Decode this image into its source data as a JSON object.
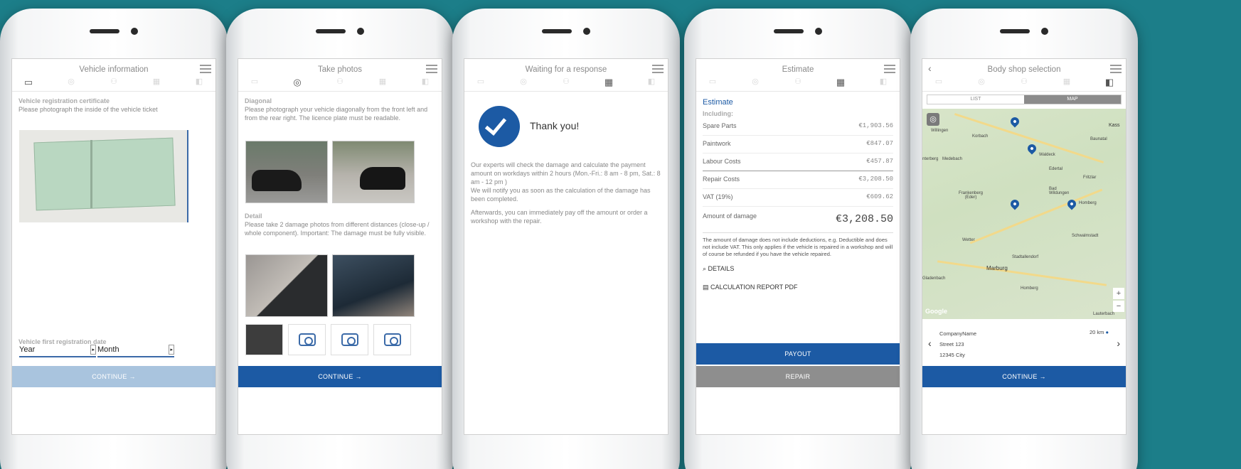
{
  "colors": {
    "background": "#1c7e89",
    "primary": "#1c5aa4",
    "disabled": "#a9c4de",
    "grey_button": "#8e8e8e",
    "map_active": "#8b8b8b"
  },
  "screens": {
    "vehicle": {
      "title": "Vehicle information",
      "reg_heading": "Vehicle registration certificate",
      "reg_text": "Please photograph the inside of the vehicle ticket",
      "date_heading": "Vehicle first registration date",
      "year": "Year",
      "month": "Month",
      "continue": "CONTINUE →"
    },
    "photos": {
      "title": "Take photos",
      "diag_heading": "Diagonal",
      "diag_text": "Please photograph your vehicle diagonally from the front left and from the rear right. The licence plate must be readable.",
      "detail_heading": "Detail",
      "detail_text": "Please take 2 damage photos from different distances (close-up / whole component). Important: The damage must be fully visible.",
      "continue": "CONTINUE →"
    },
    "waiting": {
      "title": "Waiting for a response",
      "thanks": "Thank you!",
      "text1": "Our experts will check the damage and calculate the payment amount on workdays within 2 hours (Mon.-Fri.: 8 am - 8 pm, Sat.: 8 am - 12 pm )",
      "text2": "We will notify you as soon as the calculation of the damage has been completed.",
      "text3": "Afterwards, you can immediately pay off the amount or order a workshop with the repair."
    },
    "estimate": {
      "title": "Estimate",
      "heading": "Estimate",
      "including": "Including:",
      "rows": [
        {
          "label": "Spare Parts",
          "value": "€1,903.56"
        },
        {
          "label": "Paintwork",
          "value": "€847.07"
        },
        {
          "label": "Labour Costs",
          "value": "€457.87"
        },
        {
          "label": "Repair Costs",
          "value": "€3,208.50"
        },
        {
          "label": "VAT (19%)",
          "value": "€609.62"
        }
      ],
      "total_label": "Amount of damage",
      "total_value": "€3,208.50",
      "note": "The amount of damage does not include deductions, e.g. Deductible and does not include VAT. This only applies if the vehicle is repaired in a workshop and will of course be refunded if you have the vehicle repaired.",
      "details": "DETAILS",
      "report": "CALCULATION REPORT PDF",
      "payout": "PAYOUT",
      "repair": "REPAIR"
    },
    "bodyshop": {
      "title": "Body shop selection",
      "tab_list": "LIST",
      "tab_map": "MAP",
      "places": [
        "Willingen",
        "Korbach",
        "Kass",
        "Baunatal",
        "nterberg",
        "Medebach",
        "Waldeck",
        "Edertal",
        "Fritzlar",
        "Frankenberg (Eder)",
        "Bad Wildungen",
        "Homberg",
        "Wetter",
        "Schwalmstadt",
        "Stadtallendorf",
        "Marburg",
        "Gladenbach",
        "Homberg",
        "Lauterbach"
      ],
      "google": "Google",
      "company": "CompanyName",
      "street": "Street 123",
      "city": "12345 City",
      "distance": "20 km",
      "continue": "CONTINUE →"
    }
  }
}
